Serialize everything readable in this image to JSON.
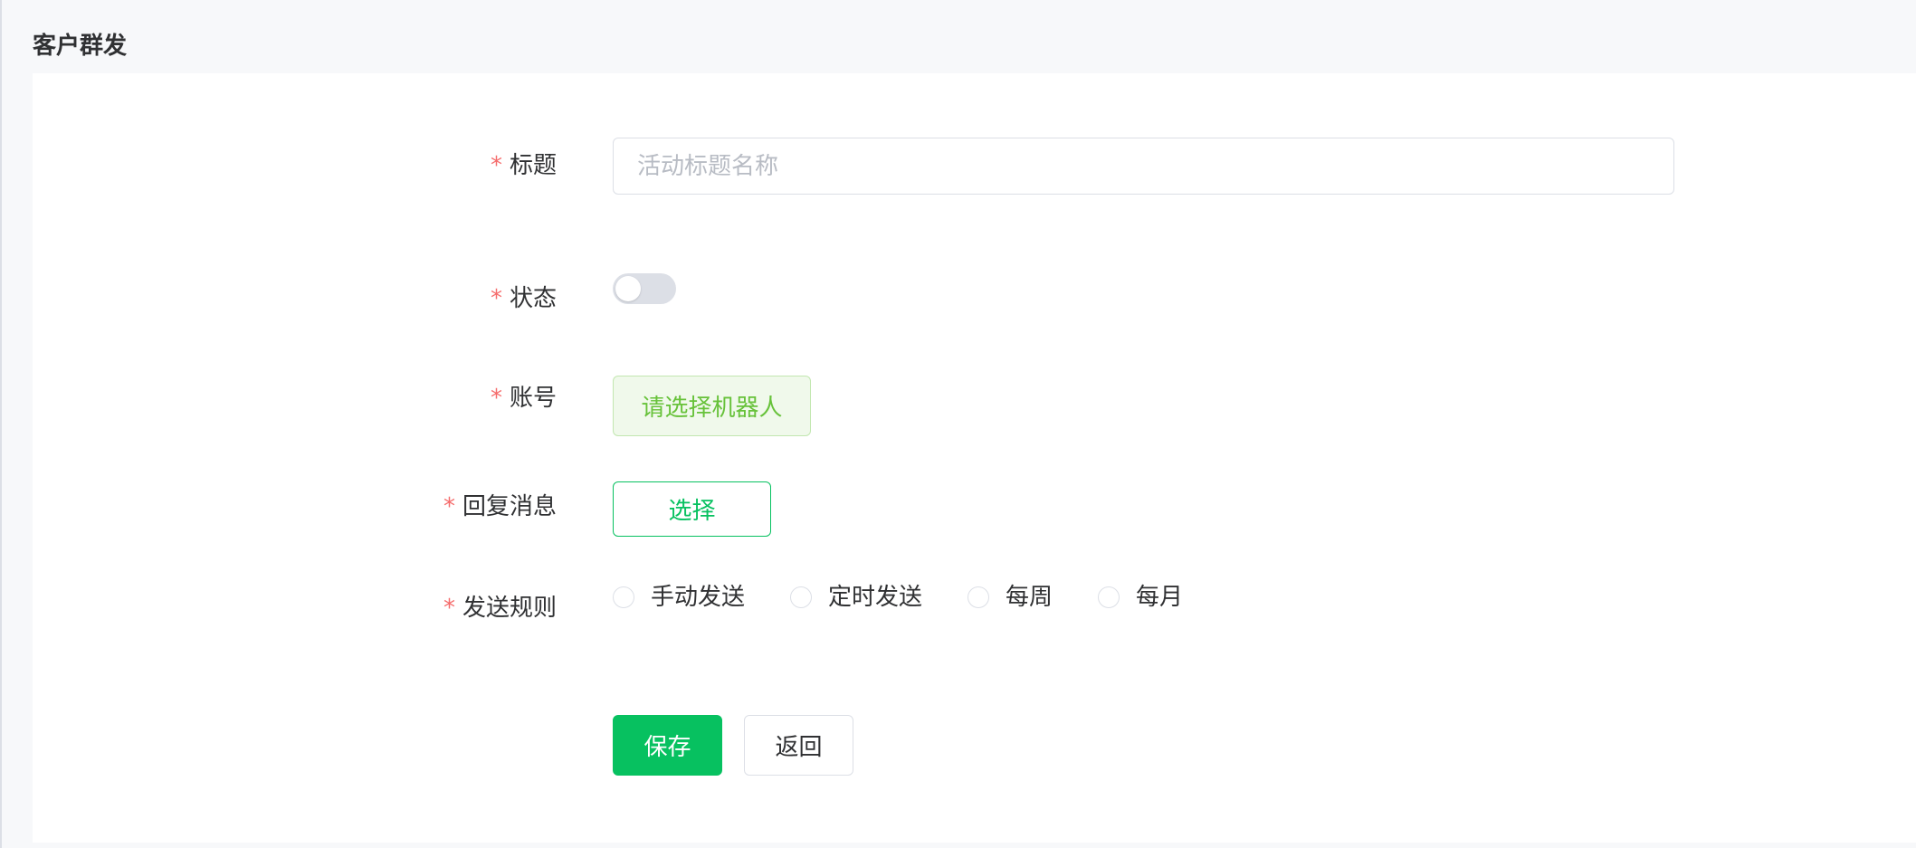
{
  "page": {
    "title": "客户群发"
  },
  "form": {
    "required_mark": "*",
    "title_field": {
      "label": "标题",
      "value": "",
      "placeholder": "活动标题名称"
    },
    "status_field": {
      "label": "状态",
      "enabled": false
    },
    "account_field": {
      "label": "账号",
      "button_label": "请选择机器人"
    },
    "reply_field": {
      "label": "回复消息",
      "button_label": "选择"
    },
    "send_rule_field": {
      "label": "发送规则",
      "options": [
        "手动发送",
        "定时发送",
        "每周",
        "每月"
      ]
    },
    "actions": {
      "save_label": "保存",
      "back_label": "返回"
    }
  },
  "colors": {
    "primary": "#07c160",
    "required": "#f56c6c",
    "light_green_bg": "#f0f9eb",
    "light_green_text": "#67c23a"
  }
}
